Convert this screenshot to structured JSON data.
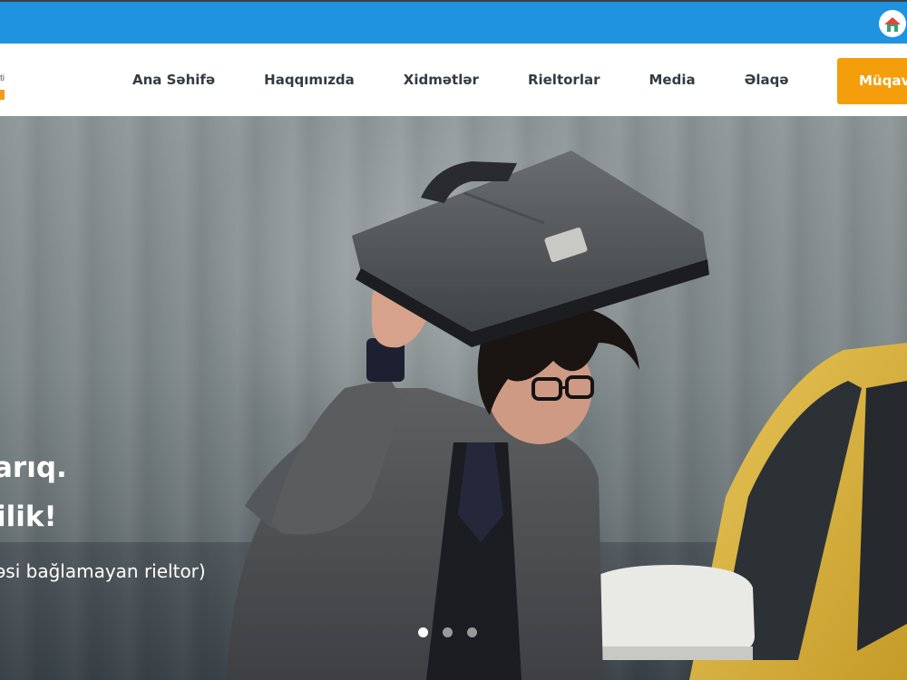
{
  "topbar": {
    "logo_icon": "house-logo-icon"
  },
  "header": {
    "logo_text": "ti",
    "nav": [
      "Ana Səhifə",
      "Haqqımızda",
      "Xidmətlər",
      "Rieltorlar",
      "Media",
      "Əlaqə"
    ],
    "cta_label": "Müqavilə"
  },
  "hero": {
    "line1": "arıq.",
    "line2": "ilik!",
    "subtitle": "əsi bağlamayan rieltor)",
    "slides": {
      "count": 3,
      "active": 1
    }
  },
  "colors": {
    "topbar": "#1f93e0",
    "cta": "#f59e0b",
    "text_dark": "#333b42"
  }
}
